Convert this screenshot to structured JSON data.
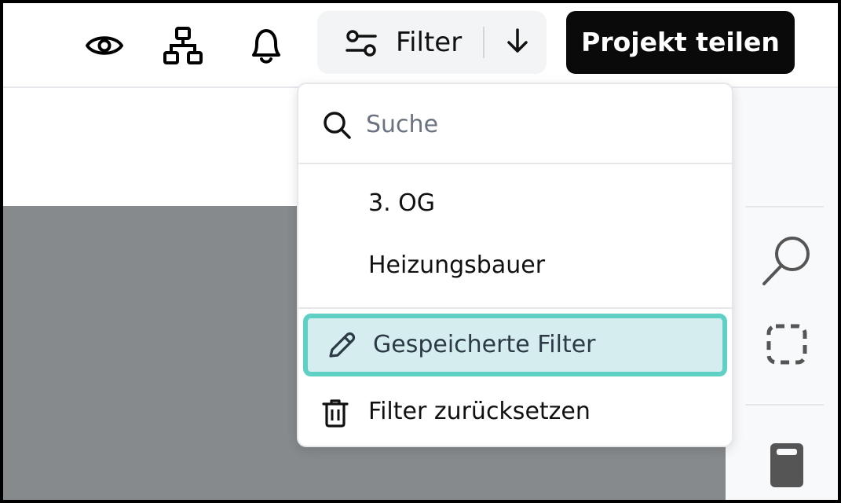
{
  "toolbar": {
    "icons": {
      "view": "eye-icon",
      "structure": "sitemap-icon",
      "notifications": "bell-icon"
    },
    "filter": {
      "icon": "sliders-icon",
      "label": "Filter",
      "arrow_icon": "arrow-down-icon"
    },
    "share_label": "Projekt teilen"
  },
  "filter_menu": {
    "search": {
      "icon": "search-icon",
      "placeholder": "Suche",
      "value": ""
    },
    "items": [
      {
        "label": "3. OG"
      },
      {
        "label": "Heizungsbauer"
      }
    ],
    "actions": [
      {
        "icon": "pencil-icon",
        "label": "Gespeicherte Filter",
        "highlighted": true
      },
      {
        "icon": "trash-icon",
        "label": "Filter zurücksetzen",
        "highlighted": false
      }
    ]
  },
  "side_tools": {
    "icons": [
      "magnifier-icon",
      "dashed-selection-icon",
      "document-icon"
    ]
  },
  "colors": {
    "share_button_bg": "#0a0a0a",
    "highlight_bg": "#d6edf0",
    "highlight_border": "#5fd1c4",
    "canvas_gray": "#868a8c",
    "toolstrip_bg": "#f8f9fa"
  }
}
